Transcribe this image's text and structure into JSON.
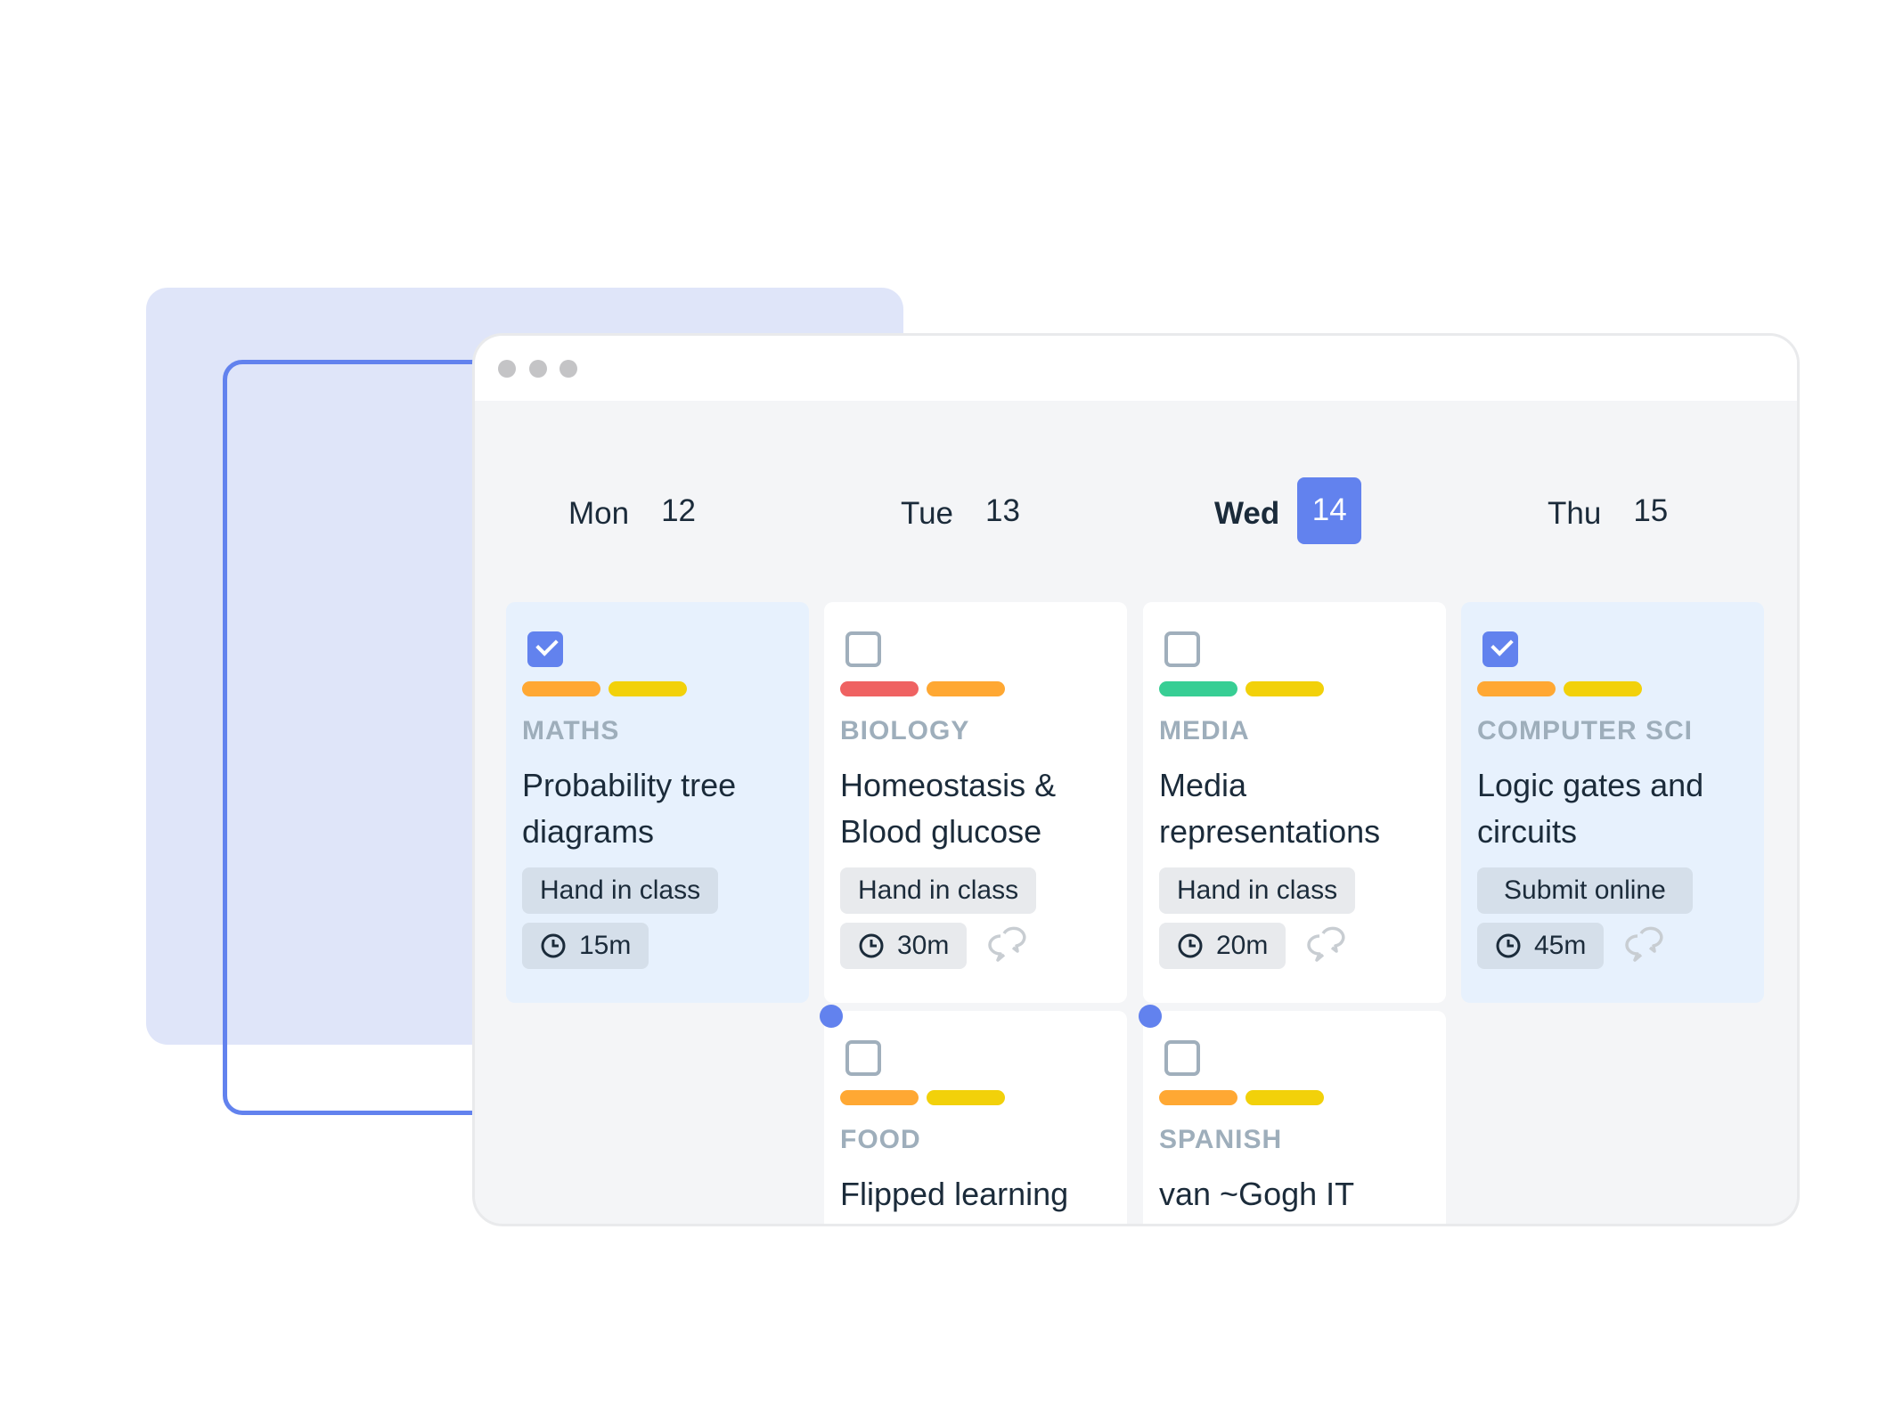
{
  "colors": {
    "accent": "#6282ee",
    "tag_orange": "#ffa833",
    "tag_yellow": "#f2d10a",
    "tag_red": "#ef6262",
    "tag_green": "#37ce94"
  },
  "window": {
    "controls": [
      "window-dot",
      "window-dot",
      "window-dot"
    ]
  },
  "days": [
    {
      "name": "Mon",
      "date": "12",
      "today": false
    },
    {
      "name": "Tue",
      "date": "13",
      "today": false
    },
    {
      "name": "Wed",
      "date": "14",
      "today": true
    },
    {
      "name": "Thu",
      "date": "15",
      "today": false
    }
  ],
  "cards": [
    {
      "day": "Mon",
      "completed": true,
      "tags": [
        "#ffa833",
        "#f2d10a"
      ],
      "subject": "MATHS",
      "title": "Probability tree diagrams",
      "submission": "Hand in class",
      "duration": "15m",
      "has_comments": false,
      "icon_clock": "clock-icon"
    },
    {
      "day": "Tue",
      "completed": false,
      "tags": [
        "#ef6262",
        "#ffa833"
      ],
      "subject": "BIOLOGY",
      "title": "Homeostasis & Blood glucose",
      "submission": "Hand in class",
      "duration": "30m",
      "has_comments": true,
      "icon_clock": "clock-icon",
      "icon_comment": "comments-icon"
    },
    {
      "day": "Wed",
      "completed": false,
      "tags": [
        "#37ce94",
        "#f2d10a"
      ],
      "subject": "MEDIA",
      "title": "Media representations",
      "submission": "Hand in class",
      "duration": "20m",
      "has_comments": true,
      "icon_clock": "clock-icon",
      "icon_comment": "comments-icon"
    },
    {
      "day": "Thu",
      "completed": true,
      "tags": [
        "#ffa833",
        "#f2d10a"
      ],
      "subject": "COMPUTER SCI",
      "title": "Logic gates and circuits",
      "submission": "Submit online",
      "duration": "45m",
      "has_comments": true,
      "icon_clock": "clock-icon",
      "icon_comment": "comments-icon"
    },
    {
      "day": "Tue",
      "completed": false,
      "tags": [
        "#ffa833",
        "#f2d10a"
      ],
      "subject": "FOOD",
      "title": "Flipped learning",
      "new_marker": true
    },
    {
      "day": "Wed",
      "completed": false,
      "tags": [
        "#ffa833",
        "#f2d10a"
      ],
      "subject": "SPANISH",
      "title": "van ~Gogh IT",
      "new_marker": true
    }
  ]
}
